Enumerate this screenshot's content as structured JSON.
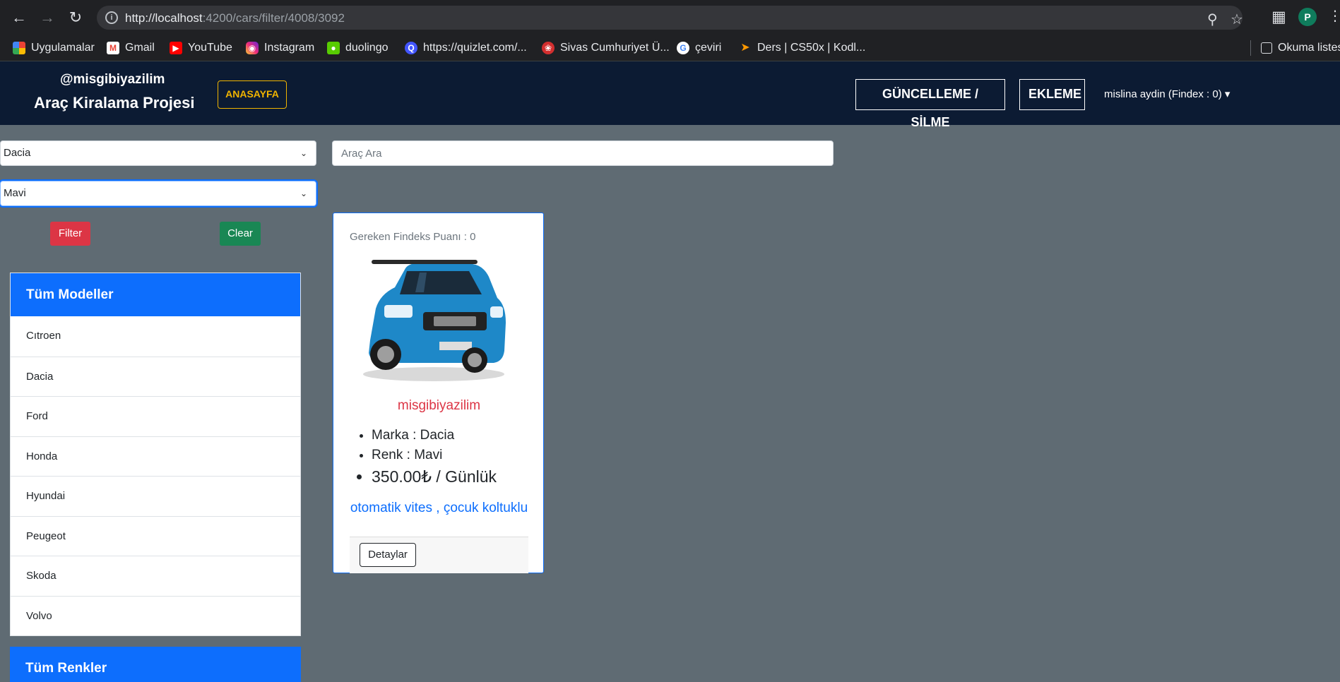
{
  "browser": {
    "url_host": "http://localhost",
    "url_path": ":4200/cars/filter/4008/3092",
    "profile_initial": "P",
    "bookmarks": [
      {
        "label": "Uygulamalar"
      },
      {
        "label": "Gmail"
      },
      {
        "label": "YouTube"
      },
      {
        "label": "Instagram"
      },
      {
        "label": "duolingo"
      },
      {
        "label": "https://quizlet.com/..."
      },
      {
        "label": "Sivas Cumhuriyet Ü..."
      },
      {
        "label": "çeviri"
      },
      {
        "label": "Ders | CS50x | Kodl..."
      }
    ],
    "reading_list": "Okuma listesi"
  },
  "header": {
    "brand_user": "@misgibiyazilim",
    "brand_title": "Araç Kiralama Projesi",
    "home_button": "ANASAYFA",
    "update_delete_button": "GÜNCELLEME / SİLME",
    "add_button": "EKLEME",
    "user_menu": "mislina aydin (Findex : 0)"
  },
  "filters": {
    "brand_select": "Dacia",
    "color_select": "Mavi",
    "search_placeholder": "Araç Ara",
    "filter_button": "Filter",
    "clear_button": "Clear"
  },
  "models": {
    "title": "Tüm Modeller",
    "items": [
      "Cıtroen",
      "Dacia",
      "Ford",
      "Honda",
      "Hyundai",
      "Peugeot",
      "Skoda",
      "Volvo"
    ]
  },
  "colors": {
    "title": "Tüm Renkler"
  },
  "car": {
    "findeks": "Gereken Findeks Puanı : 0",
    "name": "misgibiyazilim",
    "brand": "Marka : Dacia",
    "color": "Renk : Mavi",
    "price": "350.00₺ / Günlük",
    "features": "otomatik vites , çocuk koltuklu",
    "detail_button": "Detaylar"
  },
  "theme": {
    "header_bg": "#0c1b33",
    "page_bg": "#5f6b73",
    "primary": "#0d6efd",
    "danger": "#dc3545",
    "success": "#198754",
    "warning": "#f0b400"
  }
}
